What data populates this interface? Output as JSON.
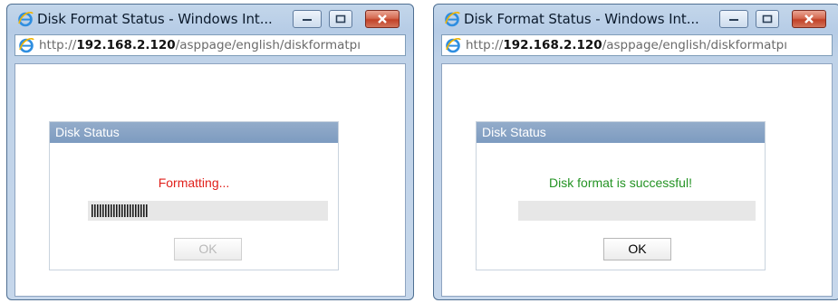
{
  "windows": [
    {
      "title": "Disk Format Status - Windows Int...",
      "url_prefix": "http://",
      "url_host": "192.168.2.120",
      "url_path": "/asppage/english/diskformatpı",
      "panel_title": "Disk Status",
      "status_text": "Formatting...",
      "status_color": "#e0201b",
      "progress_fraction": 0.24,
      "ok_label": "OK",
      "ok_enabled": false
    },
    {
      "title": "Disk Format Status - Windows Int...",
      "url_prefix": "http://",
      "url_host": "192.168.2.120",
      "url_path": "/asppage/english/diskformatpı",
      "panel_title": "Disk Status",
      "status_text": "Disk format is successful!",
      "status_color": "#249324",
      "progress_fraction": 0,
      "ok_label": "OK",
      "ok_enabled": true
    }
  ],
  "icons": {
    "browser": "ie-icon",
    "minimize": "minimize-icon",
    "maximize": "maximize-icon",
    "close": "close-icon"
  }
}
